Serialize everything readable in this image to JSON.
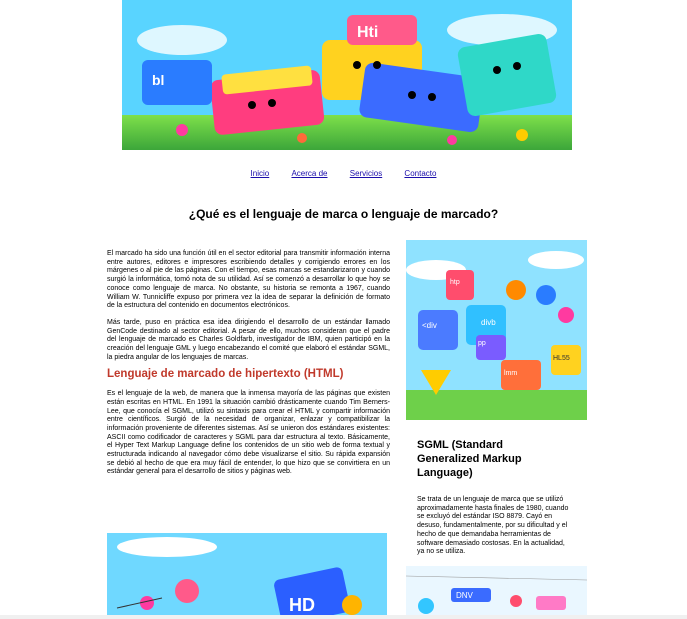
{
  "hero": {
    "tags": [
      "Hti",
      "bl"
    ]
  },
  "nav": {
    "items": [
      "Inicio",
      "Acerca de",
      "Servicios",
      "Contacto"
    ]
  },
  "main_title": "¿Qué es el lenguaje de marca o lenguaje de marcado?",
  "left": {
    "p1": "El marcado ha sido una función útil en el sector editorial para transmitir información interna entre autores, editores e impresores escribiendo detalles y corrigiendo errores en los márgenes o al pie de las páginas. Con el tiempo, esas marcas se estandarizaron y cuando surgió la informática, tomó nota de su utilidad. Así se comenzó a desarrollar lo que hoy se conoce como lenguaje de marca. No obstante, su historia se remonta a 1967, cuando William W. Tunnicliffe expuso por primera vez la idea de separar la definición de formato de la estructura del contenido en documentos electrónicos.",
    "p2": "Más tarde, puso en práctica esa idea dirigiendo el desarrollo de un estándar llamado GenCode destinado al sector editorial. A pesar de ello, muchos consideran que el padre del lenguaje de marcado es Charles Goldfarb, investigador de IBM, quien participó en la creación del lenguaje GML y luego encabezando el comité que elaboró el estándar SGML, la piedra angular de los lenguajes de marcas.",
    "h2": "Lenguaje de marcado de hipertexto (HTML)",
    "p3": "Es el lenguaje de la web, de manera que la inmensa mayoría de las páginas que existen están escritas en HTML. En 1991 la situación cambió drásticamente cuando Tim Berners-Lee, que conocía el SGML, utilizó su sintaxis para crear el HTML y compartir información entre científicos. Surgió de la necesidad de organizar, enlazar y compatibilizar la información proveniente de diferentes sistemas. Así se unieron dos estándares existentes: ASCII como codificador de caracteres y SGML para dar estructura al texto. Básicamente, el Hyper Text Markup Language define los contenidos de un sitio web de forma textual y estructurada indicando al navegador cómo debe visualizarse el sitio. Su rápida expansión se debió al hecho de que era muy fácil de entender, lo que hizo que se convirtiera en un estándar general para el desarrollo de sitios y páginas web."
  },
  "right": {
    "image_tags": [
      "htp",
      "<div",
      "divb",
      "pp",
      "lmm",
      "HL55"
    ],
    "h3": "SGML (Standard Generalized Markup Language)",
    "p": "Se trata de un lenguaje de marca que se utilizó aproximadamente hasta finales de 1980, cuando se excluyó del estándar ISO 8879. Cayó en desuso, fundamentalmente, por su dificultad y el hecho de que demandaba herramientas de software demasiado costosas. En la actualidad, ya no se utiliza."
  },
  "bottom_left": {
    "tag": "HD"
  },
  "bottom_right": {
    "tag": "DNV"
  }
}
